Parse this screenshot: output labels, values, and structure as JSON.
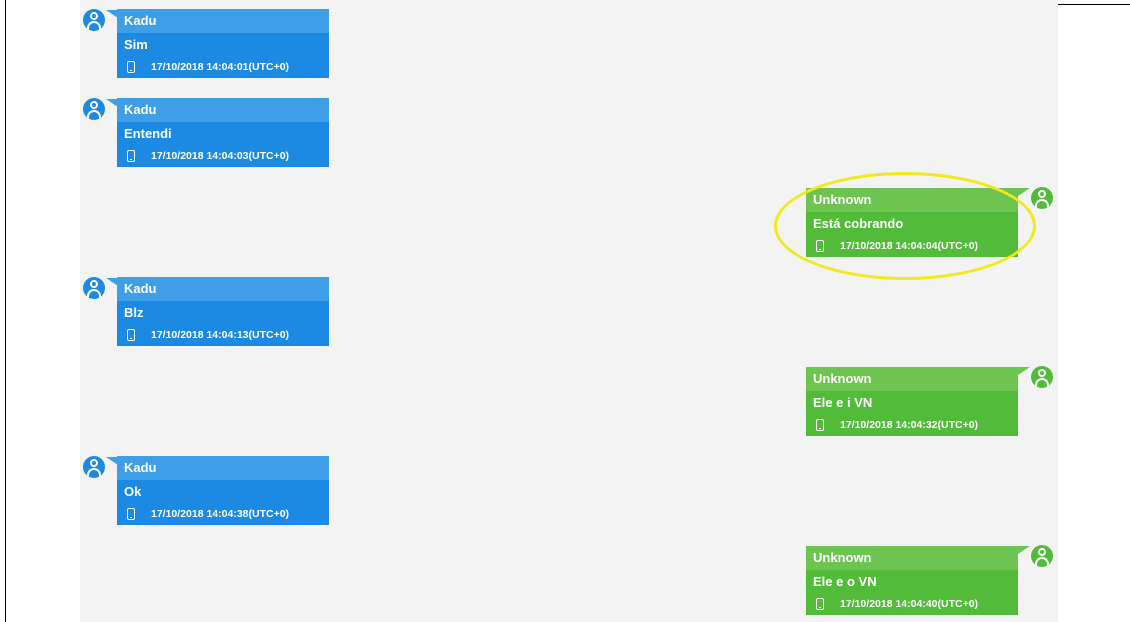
{
  "colors": {
    "incoming": "#1c8ae3",
    "outgoing": "#52bb3a",
    "highlight": "#f2e81c",
    "background": "#f3f3f3"
  },
  "messages": [
    {
      "sender": "Kadu",
      "text": "Sim",
      "timestamp": "17/10/2018 14:04:01(UTC+0)",
      "direction": "incoming",
      "icon": "phone-icon"
    },
    {
      "sender": "Kadu",
      "text": "Entendi",
      "timestamp": "17/10/2018 14:04:03(UTC+0)",
      "direction": "incoming",
      "icon": "phone-icon"
    },
    {
      "sender": "Unknown",
      "text": "Está cobrando",
      "timestamp": "17/10/2018 14:04:04(UTC+0)",
      "direction": "outgoing",
      "icon": "phone-icon",
      "highlighted": true
    },
    {
      "sender": "Kadu",
      "text": "Blz",
      "timestamp": "17/10/2018 14:04:13(UTC+0)",
      "direction": "incoming",
      "icon": "phone-icon"
    },
    {
      "sender": "Unknown",
      "text": "Ele e i VN",
      "timestamp": "17/10/2018 14:04:32(UTC+0)",
      "direction": "outgoing",
      "icon": "phone-icon"
    },
    {
      "sender": "Kadu",
      "text": "Ok",
      "timestamp": "17/10/2018 14:04:38(UTC+0)",
      "direction": "incoming",
      "icon": "phone-icon"
    },
    {
      "sender": "Unknown",
      "text": "Ele e o VN",
      "timestamp": "17/10/2018 14:04:40(UTC+0)",
      "direction": "outgoing",
      "icon": "phone-icon"
    }
  ]
}
